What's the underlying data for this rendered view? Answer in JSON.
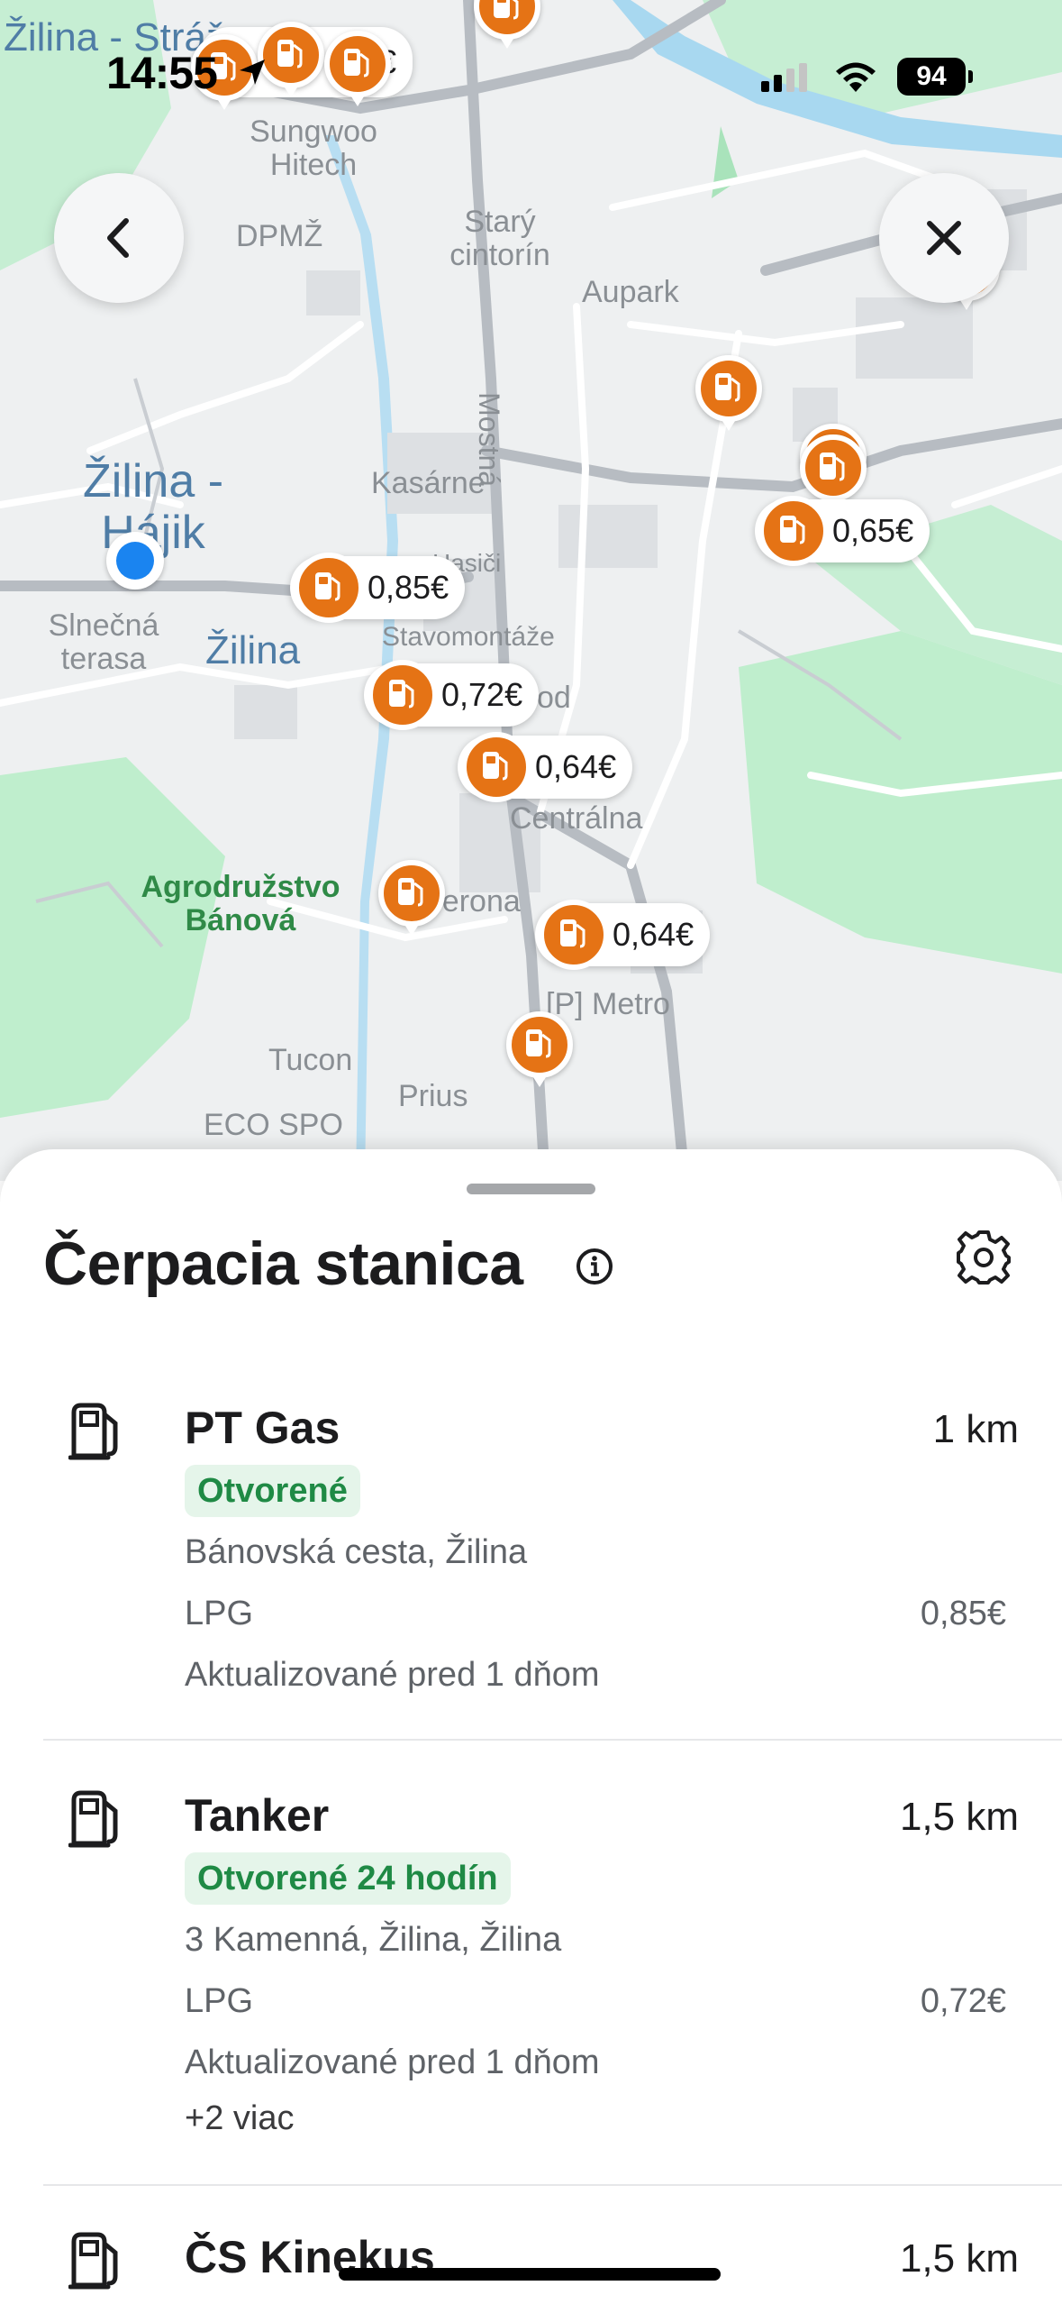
{
  "status_bar": {
    "time": "14:55",
    "battery": "94"
  },
  "map": {
    "labels": {
      "zilina_strazov": "Žilina - Strážov",
      "sungwoo": "Sungwoo Hitech",
      "dpmz": "DPMŽ",
      "stary_cintorin": "Starý cintorín",
      "aupark": "Aupark",
      "mostna": "Mostná",
      "zilina_hajik": "Žilina - Hájik",
      "kasarne": "Kasárne",
      "hasici": "Hasiči",
      "slnecna": "Slnečná terasa",
      "zilina": "Žilina",
      "stavomontaze": "Stavomontáže",
      "od": "od",
      "centralna": "Centrálna",
      "agrodruzstvo": "Agrodružstvo Bánová",
      "verona": "Verona",
      "metro": "[P] Metro",
      "tucon": "Tucon",
      "prius": "Prius",
      "eco_spo": "ECO SPO"
    },
    "prices": {
      "p085": "0,85€",
      "p072": "0,72€",
      "p064a": "0,64€",
      "p065": "0,65€",
      "p064b": "0,64€",
      "p_top": "€"
    },
    "pin_icon": "fuel-pump-icon",
    "pin_color": "#e57315"
  },
  "sheet": {
    "title": "Čerpacia stanica",
    "stations": [
      {
        "name": "PT Gas",
        "distance": "1 km",
        "status": "Otvorené",
        "address": "Bánovská cesta, Žilina",
        "fuel": "LPG",
        "price": "0,85€",
        "updated": "Aktualizované pred 1 dňom"
      },
      {
        "name": "Tanker",
        "distance": "1,5 km",
        "status": "Otvorené 24 hodín",
        "address": "3 Kamenná, Žilina, Žilina",
        "fuel": "LPG",
        "price": "0,72€",
        "updated": "Aktualizované pred 1 dňom",
        "more": "+2 viac"
      },
      {
        "name": "ČS Kinekus",
        "distance": "1,5 km"
      }
    ]
  },
  "colors": {
    "accent": "#e57315",
    "open_green": "#1f8a45",
    "map_green": "#bfeecd",
    "map_water": "#a8d8f0"
  }
}
